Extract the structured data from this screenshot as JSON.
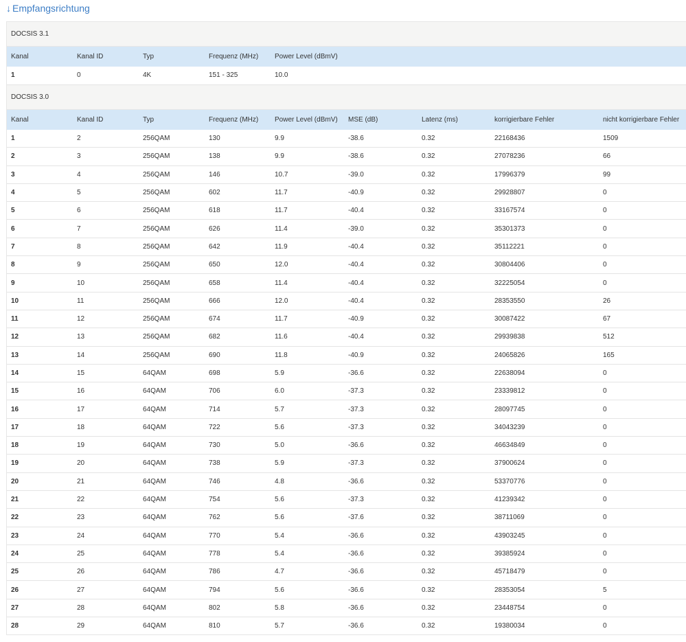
{
  "heading": {
    "arrow": "↓",
    "label": "Empfangsrichtung"
  },
  "docsis31": {
    "title": "DOCSIS 3.1",
    "headers": [
      "Kanal",
      "Kanal ID",
      "Typ",
      "Frequenz (MHz)",
      "Power Level (dBmV)"
    ],
    "rows": [
      [
        "1",
        "0",
        "4K",
        "151 - 325",
        "10.0"
      ]
    ]
  },
  "docsis30": {
    "title": "DOCSIS 3.0",
    "headers": [
      "Kanal",
      "Kanal ID",
      "Typ",
      "Frequenz (MHz)",
      "Power Level (dBmV)",
      "MSE (dB)",
      "Latenz (ms)",
      "korrigierbare Fehler",
      "nicht korrigierbare Fehler"
    ],
    "rows": [
      [
        "1",
        "2",
        "256QAM",
        "130",
        "9.9",
        "-38.6",
        "0.32",
        "22168436",
        "1509"
      ],
      [
        "2",
        "3",
        "256QAM",
        "138",
        "9.9",
        "-38.6",
        "0.32",
        "27078236",
        "66"
      ],
      [
        "3",
        "4",
        "256QAM",
        "146",
        "10.7",
        "-39.0",
        "0.32",
        "17996379",
        "99"
      ],
      [
        "4",
        "5",
        "256QAM",
        "602",
        "11.7",
        "-40.9",
        "0.32",
        "29928807",
        "0"
      ],
      [
        "5",
        "6",
        "256QAM",
        "618",
        "11.7",
        "-40.4",
        "0.32",
        "33167574",
        "0"
      ],
      [
        "6",
        "7",
        "256QAM",
        "626",
        "11.4",
        "-39.0",
        "0.32",
        "35301373",
        "0"
      ],
      [
        "7",
        "8",
        "256QAM",
        "642",
        "11.9",
        "-40.4",
        "0.32",
        "35112221",
        "0"
      ],
      [
        "8",
        "9",
        "256QAM",
        "650",
        "12.0",
        "-40.4",
        "0.32",
        "30804406",
        "0"
      ],
      [
        "9",
        "10",
        "256QAM",
        "658",
        "11.4",
        "-40.4",
        "0.32",
        "32225054",
        "0"
      ],
      [
        "10",
        "11",
        "256QAM",
        "666",
        "12.0",
        "-40.4",
        "0.32",
        "28353550",
        "26"
      ],
      [
        "11",
        "12",
        "256QAM",
        "674",
        "11.7",
        "-40.9",
        "0.32",
        "30087422",
        "67"
      ],
      [
        "12",
        "13",
        "256QAM",
        "682",
        "11.6",
        "-40.4",
        "0.32",
        "29939838",
        "512"
      ],
      [
        "13",
        "14",
        "256QAM",
        "690",
        "11.8",
        "-40.9",
        "0.32",
        "24065826",
        "165"
      ],
      [
        "14",
        "15",
        "64QAM",
        "698",
        "5.9",
        "-36.6",
        "0.32",
        "22638094",
        "0"
      ],
      [
        "15",
        "16",
        "64QAM",
        "706",
        "6.0",
        "-37.3",
        "0.32",
        "23339812",
        "0"
      ],
      [
        "16",
        "17",
        "64QAM",
        "714",
        "5.7",
        "-37.3",
        "0.32",
        "28097745",
        "0"
      ],
      [
        "17",
        "18",
        "64QAM",
        "722",
        "5.6",
        "-37.3",
        "0.32",
        "34043239",
        "0"
      ],
      [
        "18",
        "19",
        "64QAM",
        "730",
        "5.0",
        "-36.6",
        "0.32",
        "46634849",
        "0"
      ],
      [
        "19",
        "20",
        "64QAM",
        "738",
        "5.9",
        "-37.3",
        "0.32",
        "37900624",
        "0"
      ],
      [
        "20",
        "21",
        "64QAM",
        "746",
        "4.8",
        "-36.6",
        "0.32",
        "53370776",
        "0"
      ],
      [
        "21",
        "22",
        "64QAM",
        "754",
        "5.6",
        "-37.3",
        "0.32",
        "41239342",
        "0"
      ],
      [
        "22",
        "23",
        "64QAM",
        "762",
        "5.6",
        "-37.6",
        "0.32",
        "38711069",
        "0"
      ],
      [
        "23",
        "24",
        "64QAM",
        "770",
        "5.4",
        "-36.6",
        "0.32",
        "43903245",
        "0"
      ],
      [
        "24",
        "25",
        "64QAM",
        "778",
        "5.4",
        "-36.6",
        "0.32",
        "39385924",
        "0"
      ],
      [
        "25",
        "26",
        "64QAM",
        "786",
        "4.7",
        "-36.6",
        "0.32",
        "45718479",
        "0"
      ],
      [
        "26",
        "27",
        "64QAM",
        "794",
        "5.6",
        "-36.6",
        "0.32",
        "28353054",
        "5"
      ],
      [
        "27",
        "28",
        "64QAM",
        "802",
        "5.8",
        "-36.6",
        "0.32",
        "23448754",
        "0"
      ],
      [
        "28",
        "29",
        "64QAM",
        "810",
        "5.7",
        "-36.6",
        "0.32",
        "19380034",
        "0"
      ]
    ]
  }
}
